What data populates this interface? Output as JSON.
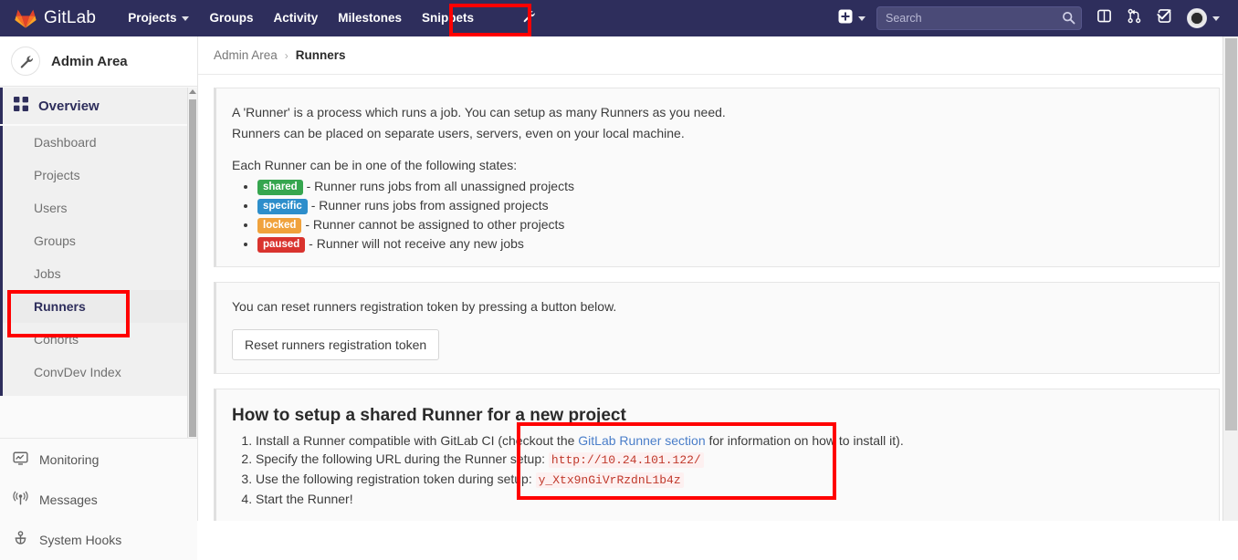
{
  "navbar": {
    "brand": "GitLab",
    "links": [
      {
        "label": "Projects",
        "has_caret": true
      },
      {
        "label": "Groups",
        "has_caret": false
      },
      {
        "label": "Activity",
        "has_caret": false
      },
      {
        "label": "Milestones",
        "has_caret": false
      },
      {
        "label": "Snippets",
        "has_caret": false
      }
    ],
    "admin_icon": "wrench-icon",
    "right": {
      "new_icon": "plus-square-icon",
      "search_placeholder": "Search",
      "search_value": "",
      "issues_icon": "issues-icon",
      "merge_requests_icon": "merge-request-icon",
      "todos_icon": "todos-check-icon",
      "avatar_icon": "user-avatar"
    }
  },
  "sidebar": {
    "title": "Admin Area",
    "title_icon": "wrench-icon",
    "section": {
      "label": "Overview",
      "icon": "grid-overview-icon",
      "items": [
        {
          "label": "Dashboard",
          "active": false
        },
        {
          "label": "Projects",
          "active": false
        },
        {
          "label": "Users",
          "active": false
        },
        {
          "label": "Groups",
          "active": false
        },
        {
          "label": "Jobs",
          "active": false
        },
        {
          "label": "Runners",
          "active": true
        },
        {
          "label": "Cohorts",
          "active": false
        },
        {
          "label": "ConvDev Index",
          "active": false
        }
      ]
    },
    "bottom_items": [
      {
        "label": "Monitoring",
        "icon": "monitor-chart-icon"
      },
      {
        "label": "Messages",
        "icon": "broadcast-icon"
      },
      {
        "label": "System Hooks",
        "icon": "hook-icon"
      }
    ]
  },
  "breadcrumb": {
    "parent": "Admin Area",
    "separator": "›",
    "current": "Runners"
  },
  "panels": {
    "info": {
      "line1": "A 'Runner' is a process which runs a job. You can setup as many Runners as you need.",
      "line2": "Runners can be placed on separate users, servers, even on your local machine.",
      "states_intro": "Each Runner can be in one of the following states:",
      "states": [
        {
          "badge": "shared",
          "color": "#36a64f",
          "text": "- Runner runs jobs from all unassigned projects"
        },
        {
          "badge": "specific",
          "color": "#2d8ecb",
          "text": "- Runner runs jobs from assigned projects"
        },
        {
          "badge": "locked",
          "color": "#f0a23c",
          "text": "- Runner cannot be assigned to other projects"
        },
        {
          "badge": "paused",
          "color": "#d9332e",
          "text": "- Runner will not receive any new jobs"
        }
      ]
    },
    "reset": {
      "text": "You can reset runners registration token by pressing a button below.",
      "button_label": "Reset runners registration token"
    },
    "setup": {
      "title": "How to setup a shared Runner for a new project",
      "step1_pre": "Install a Runner compatible with GitLab CI (checkout the ",
      "step1_link": "GitLab Runner section",
      "step1_post": " for information on how to install it).",
      "step2_pre": "Specify the following URL during the Runner setup: ",
      "step2_url": "http://10.24.101.122/",
      "step3_pre": "Use the following registration token during setup: ",
      "step3_token": "y_Xtx9nGiVrRzdnL1b4z",
      "step4": "Start the Runner!"
    }
  },
  "annotations": {
    "accent_color": "#ff0000",
    "boxes": [
      {
        "name": "admin-wrench-highlight"
      },
      {
        "name": "sidebar-runners-highlight"
      },
      {
        "name": "url-token-highlight"
      }
    ]
  }
}
